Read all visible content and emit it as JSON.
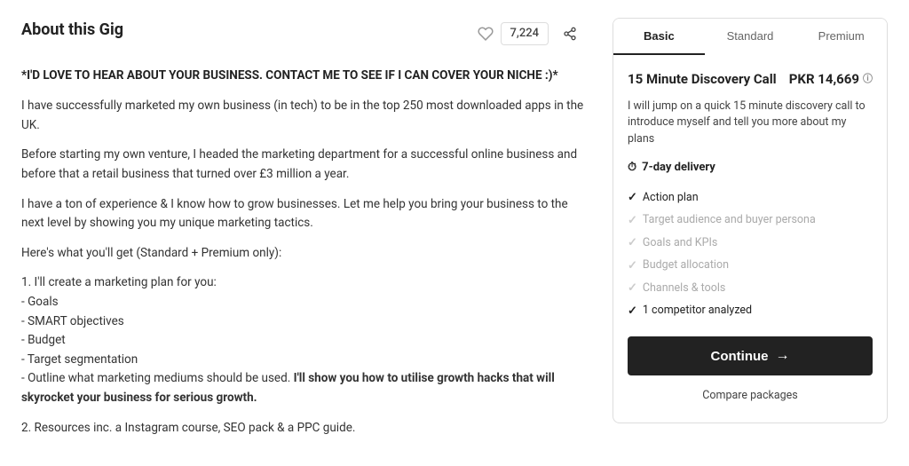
{
  "page": {
    "section_title": "About this Gig",
    "likes_count": "7,224",
    "headline": "*I'D LOVE TO HEAR ABOUT YOUR BUSINESS. CONTACT ME TO SEE IF I CAN COVER YOUR NICHE :)*",
    "paragraphs": [
      "I have successfully marketed my own business (in tech) to be in the top 250 most downloaded apps in the UK.",
      "Before starting my own venture, I headed the marketing department for a successful online business and before that a retail business that turned over £3 million a year.",
      "I have a ton of experience & I know how to grow businesses. Let me help you bring your business to the next level by showing you my unique marketing tactics.",
      "Here's what you'll get (Standard + Premium only):",
      "1. I'll create a marketing plan for you:\n- Goals\n- SMART objectives\n- Budget\n- Target segmentation\n- Outline what marketing mediums should be used. I'll show you how to utilise growth hacks that will skyrocket your business for serious growth.",
      "2. Resources inc. a Instagram course, SEO pack & a PPC guide."
    ],
    "bold_part": "I'll show you how to utilise growth hacks that will skyrocket your business for serious growth."
  },
  "pricing": {
    "tabs": [
      {
        "label": "Basic",
        "active": true
      },
      {
        "label": "Standard",
        "active": false
      },
      {
        "label": "Premium",
        "active": false
      }
    ],
    "plan_name": "15 Minute Discovery Call",
    "price": "PKR 14,669",
    "price_info_icon": "ⓘ",
    "description": "I will jump on a quick 15 minute discovery call to introduce myself and tell you more about my plans",
    "delivery_label": "7-day delivery",
    "features": [
      {
        "label": "Action plan",
        "included": true
      },
      {
        "label": "Target audience and buyer persona",
        "included": false
      },
      {
        "label": "Goals and KPIs",
        "included": false
      },
      {
        "label": "Budget allocation",
        "included": false
      },
      {
        "label": "Channels & tools",
        "included": false
      },
      {
        "label": "1 competitor analyzed",
        "included": true
      }
    ],
    "continue_label": "Continue",
    "compare_label": "Compare packages",
    "arrow": "→"
  }
}
